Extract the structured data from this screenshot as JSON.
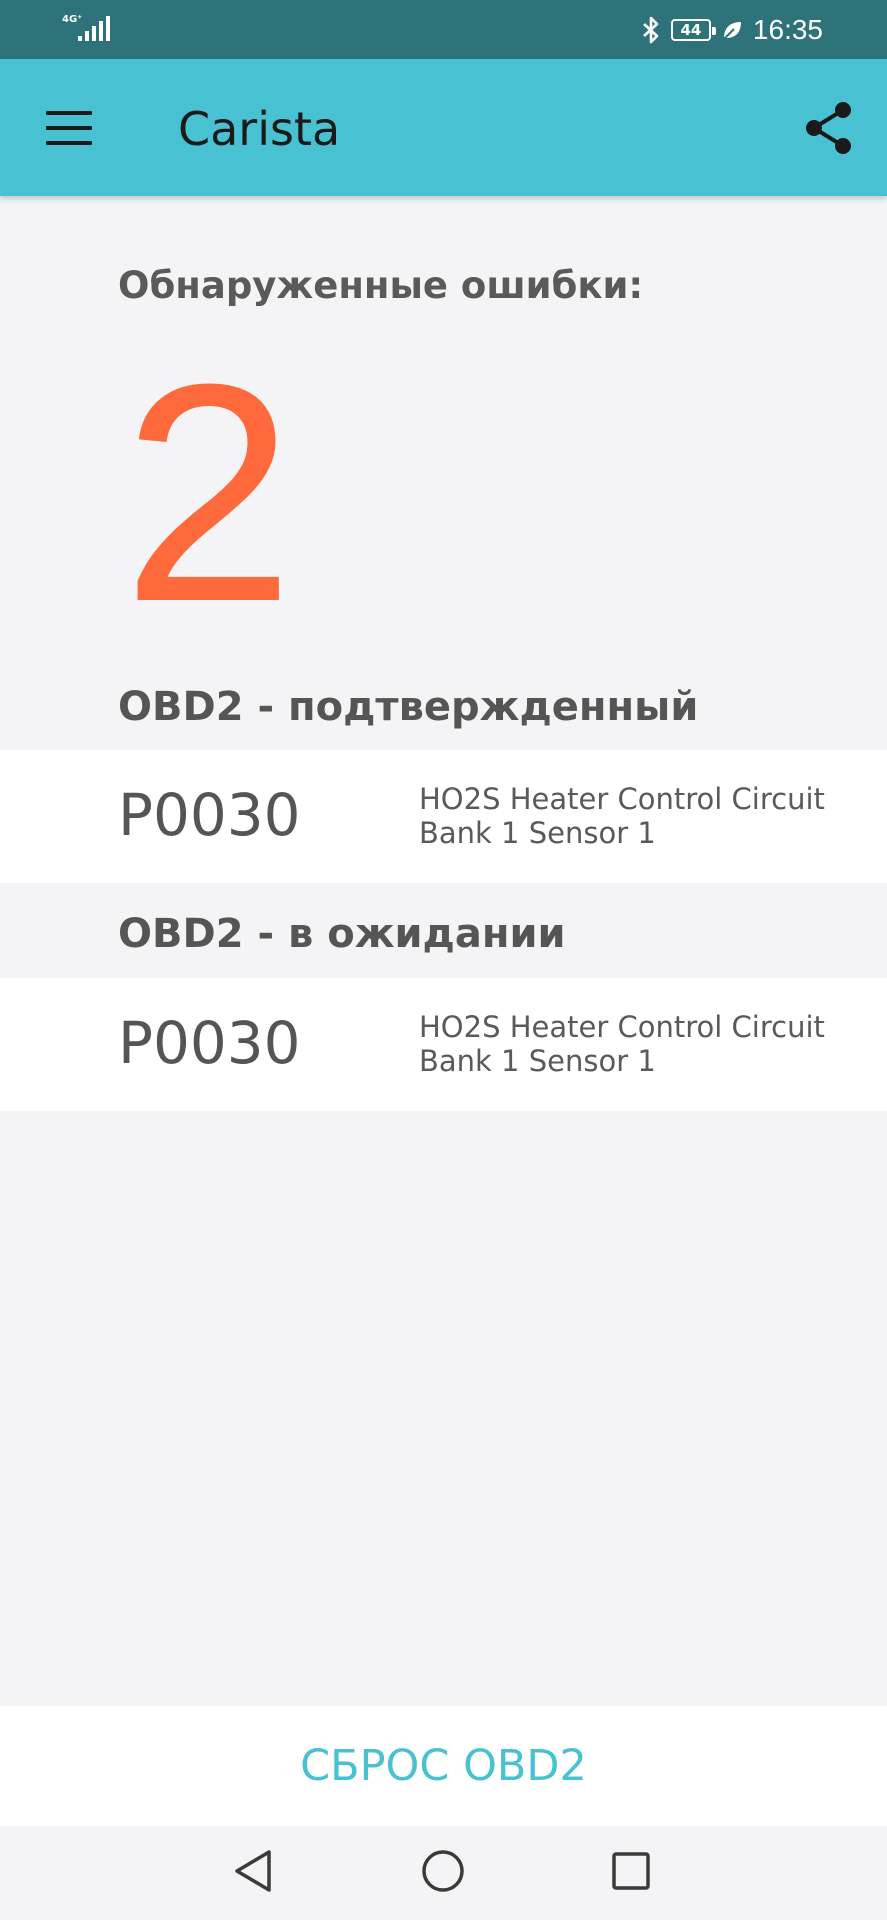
{
  "status_bar": {
    "network": "4G⁺",
    "battery": "44",
    "time": "16:35"
  },
  "app_bar": {
    "title": "Carista",
    "menu_icon": "hamburger-menu-icon",
    "share_icon": "share-icon"
  },
  "summary": {
    "label": "Обнаруженные ошибки:",
    "count": "2"
  },
  "sections": [
    {
      "title": "OBD2 - подтвержденный",
      "codes": [
        {
          "code": "P0030",
          "description": "HO2S Heater Control Circuit Bank 1 Sensor 1"
        }
      ]
    },
    {
      "title": "OBD2 - в ожидании",
      "codes": [
        {
          "code": "P0030",
          "description": "HO2S Heater Control Circuit Bank 1 Sensor 1"
        }
      ]
    }
  ],
  "actions": {
    "reset_label": "СБРОС OBD2"
  },
  "colors": {
    "status_bar": "#2e7379",
    "app_bar": "#48c2d2",
    "count": "#ff6a3d",
    "accent": "#48c2d2"
  }
}
